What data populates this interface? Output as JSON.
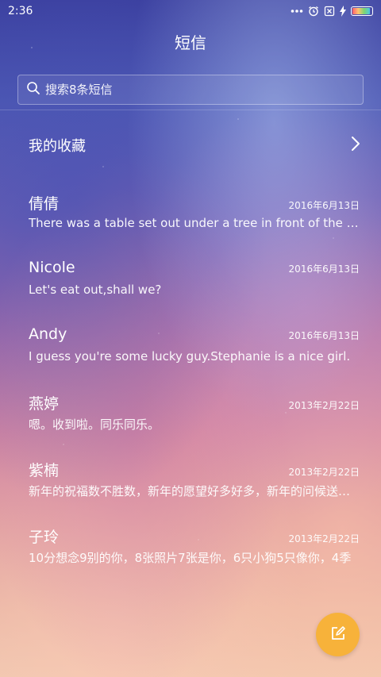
{
  "status_bar": {
    "time": "2:36",
    "icons": [
      "more-dots-icon",
      "alarm-icon",
      "sim-off-icon",
      "charging-icon",
      "battery-icon"
    ],
    "battery_level": 0.85
  },
  "header": {
    "title": "短信"
  },
  "search": {
    "placeholder": "搜索8条短信"
  },
  "favorites": {
    "label": "我的收藏"
  },
  "conversations": [
    {
      "name": "倩倩",
      "date": "2016年6月13日",
      "preview": "There was a table set out under a tree in front of the house"
    },
    {
      "name": "Nicole",
      "date": "2016年6月13日",
      "preview": "Let's eat out,shall we?"
    },
    {
      "name": "Andy",
      "date": "2016年6月13日",
      "preview": "I guess you're some lucky guy.Stephanie is a nice girl."
    },
    {
      "name": "燕婷",
      "date": "2013年2月22日",
      "preview": "嗯。收到啦。同乐同乐。"
    },
    {
      "name": "紫楠",
      "date": "2013年2月22日",
      "preview": "新年的祝福数不胜数，新年的愿望好多好多，新年的问候送给你"
    },
    {
      "name": "子玲",
      "date": "2013年2月22日",
      "preview": "10分想念9别的你，8张照片7张是你，6只小狗5只像你，4季"
    }
  ],
  "colors": {
    "accent": "#f7b23a",
    "text": "#ffffff"
  }
}
